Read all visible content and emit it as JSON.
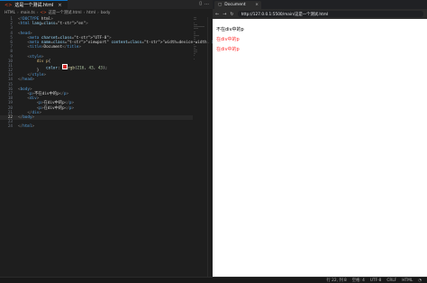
{
  "editor": {
    "tab": {
      "label": "这是一个测试.html",
      "icon": "html5-icon"
    },
    "breadcrumb": [
      "HTML",
      "main.ts",
      "这是一个测试.html",
      "html",
      "body"
    ],
    "lines": [
      {
        "n": "1",
        "t": "<!DOCTYPE html>"
      },
      {
        "n": "2",
        "t": "<html lang=\"en\">"
      },
      {
        "n": "3",
        "t": ""
      },
      {
        "n": "4",
        "t": "<head>"
      },
      {
        "n": "5",
        "t": "    <meta charset=\"UTF-8\">"
      },
      {
        "n": "6",
        "t": "    <meta name=\"viewport\" content=\"width=device-width, initial-scale=1.0\">"
      },
      {
        "n": "7",
        "t": "    <title>Document</title>"
      },
      {
        "n": "8",
        "t": ""
      },
      {
        "n": "9",
        "t": "    <style>"
      },
      {
        "n": "10",
        "t": "        div p{"
      },
      {
        "n": "11",
        "t": "            color: rgb(216, 43, 43);"
      },
      {
        "n": "12",
        "t": "        }"
      },
      {
        "n": "13",
        "t": "    </style>"
      },
      {
        "n": "14",
        "t": "</head>"
      },
      {
        "n": "15",
        "t": ""
      },
      {
        "n": "16",
        "t": "<body>"
      },
      {
        "n": "17",
        "t": "    <p>不在div中的p</p>"
      },
      {
        "n": "18",
        "t": "    <div>"
      },
      {
        "n": "19",
        "t": "        <p>在div中的p</p>"
      },
      {
        "n": "20",
        "t": "        <p>在div中的p</p>"
      },
      {
        "n": "21",
        "t": "    </div>"
      },
      {
        "n": "22",
        "t": "</body>"
      },
      {
        "n": "23",
        "t": ""
      },
      {
        "n": "24",
        "t": "</html>"
      }
    ],
    "current_line": "22"
  },
  "browser": {
    "tab_title": "Document",
    "url": "http://127.0.0.1:5500/main/这是一个测试.html",
    "paragraphs": [
      "不在div中的p",
      "在div中的p",
      "在div中的p"
    ],
    "colors": {
      "outer": "#000000",
      "inner": "#ff2d2d"
    }
  },
  "statusbar": {
    "position": "行 22, 列 8",
    "spaces": "空格: 4",
    "encoding": "UTF-8",
    "eol": "CRLF",
    "language": "HTML"
  }
}
